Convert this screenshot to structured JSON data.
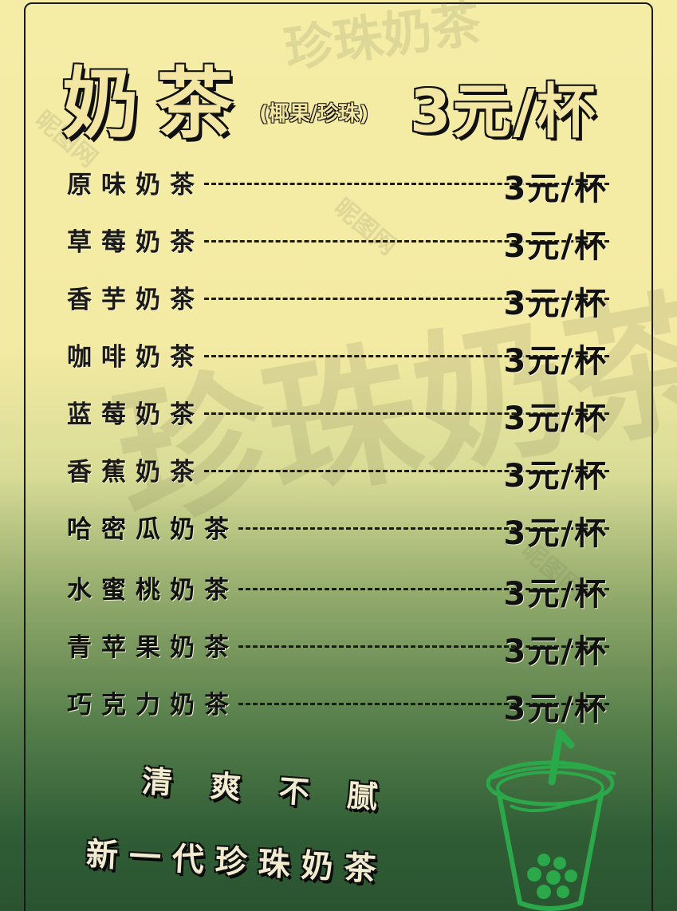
{
  "watermark": {
    "top_text": "珍珠奶茶",
    "mid_text": "珍珠奶茶",
    "logo_text": "昵图网"
  },
  "header": {
    "title": "奶茶",
    "subtitle": "(椰果/珍珠)",
    "price": "3元/杯"
  },
  "menu": {
    "items": [
      {
        "name": "原味奶茶",
        "price": "3元/杯"
      },
      {
        "name": "草莓奶茶",
        "price": "3元/杯"
      },
      {
        "name": "香芋奶茶",
        "price": "3元/杯"
      },
      {
        "name": "咖啡奶茶",
        "price": "3元/杯"
      },
      {
        "name": "蓝莓奶茶",
        "price": "3元/杯"
      },
      {
        "name": "香蕉奶茶",
        "price": "3元/杯"
      },
      {
        "name": "哈密瓜奶茶",
        "price": "3元/杯"
      },
      {
        "name": "水蜜桃奶茶",
        "price": "3元/杯"
      },
      {
        "name": "青苹果奶茶",
        "price": "3元/杯"
      },
      {
        "name": "巧克力奶茶",
        "price": "3元/杯"
      }
    ]
  },
  "slogan": {
    "line1": "清爽不腻",
    "line2": "新一代珍珠奶茶"
  },
  "colors": {
    "title_fill": "#f3e6a2",
    "outline": "#111111",
    "cup_green": "#2aa84a"
  },
  "icons": {
    "cup": "bubble-tea-cup-icon"
  }
}
